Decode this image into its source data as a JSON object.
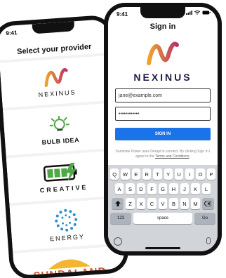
{
  "back_screen": {
    "time": "9:41",
    "title": "Select your provider",
    "providers": [
      {
        "name": "NEXINUS"
      },
      {
        "name": "BULB IDEA"
      },
      {
        "name": "CREATIVE"
      },
      {
        "name": "ENERGY"
      },
      {
        "name": "SUNDALAND"
      }
    ]
  },
  "front_screen": {
    "time": "9:41",
    "title": "Sign in",
    "brand": "NEXINUS",
    "email_value": "jane@example.com",
    "password_value": "••••••••••••",
    "signin_label": "SIGN IN",
    "disclaimer_text": "Sunshine Power uses Derapi to connect. By clicking Sign In I agree to the ",
    "disclaimer_link": "Terms and Conditions",
    "disclaimer_end": "."
  },
  "keyboard": {
    "row1": [
      "Q",
      "W",
      "E",
      "R",
      "T",
      "Y",
      "U",
      "I",
      "O",
      "P"
    ],
    "row2": [
      "A",
      "S",
      "D",
      "F",
      "G",
      "H",
      "J",
      "K",
      "L"
    ],
    "row3": [
      "Z",
      "X",
      "C",
      "V",
      "B",
      "N",
      "M"
    ],
    "num_label": "123",
    "space_label": "space",
    "go_label": "Go"
  },
  "colors": {
    "accent_blue": "#1a73e8",
    "brand_navy": "#1d1d4a",
    "nexinus_gradient_start": "#f0a32b",
    "nexinus_gradient_end": "#b8336a",
    "battery_green": "#4fa845"
  }
}
